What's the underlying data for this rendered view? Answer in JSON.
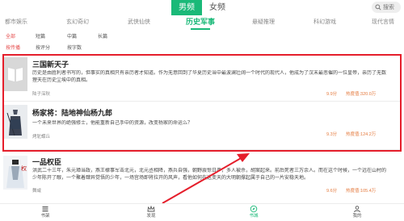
{
  "top": {
    "gender_tabs": [
      "男频",
      "女频"
    ],
    "search_label": "搜索"
  },
  "categories": [
    "都市娱乐",
    "玄幻奇幻",
    "武侠仙侠",
    "历史军事",
    "悬疑推理",
    "科幻游戏",
    "现代言情"
  ],
  "filters": {
    "length": [
      "全部",
      "短篇",
      "中篇",
      "长篇"
    ],
    "sort": [
      "按传播",
      "按评分",
      "按字数"
    ]
  },
  "books": [
    {
      "title": "三国新天子",
      "desc": "历史是由胜利者书写的，但事实的真相只有亲历者才知道。作为无意回到了华夏历史当中最波澜壮阔一个时代的现代人，他成为了汉末最悲催的一位皇帝，亲历了无数狸天在历史尘埃中的真相。",
      "author": "陆子深秋",
      "score": "9.9分",
      "heat": "热度值:320.0万"
    },
    {
      "title": "杨家将：陆地神仙杨九郎",
      "desc": "一个未来世界的绝强修士，他能重新自己手中的资源，改变杨家的命运么？",
      "author": "烤鸵蝶丘",
      "score": "9.3分",
      "heat": "热度值:124.2万"
    },
    {
      "title": "一品权臣",
      "desc": "洪武二十三年，朱元璋当政，燕王棣事军击北元，北元丞相降，燕兵自强，朝野震惊日严，多人被杀，胡案起来。前后死者三万余人。而在这个时候，一个远在山村的少年陈开了眼，一个聚着肆异觉悟的少年，一场宫场即将拉开的风声，看他如何在这变天的大明朝撑起属于自己的一片安稳天地。",
      "author": "舞咸",
      "score": "9.6分",
      "heat": "热度值:105.4万"
    }
  ],
  "bottom_nav": [
    "书架",
    "发现",
    "书城",
    "我的"
  ],
  "colors": {
    "accent": "#1ab978",
    "highlight": "#e51e2b",
    "stat": "#e4793c"
  }
}
